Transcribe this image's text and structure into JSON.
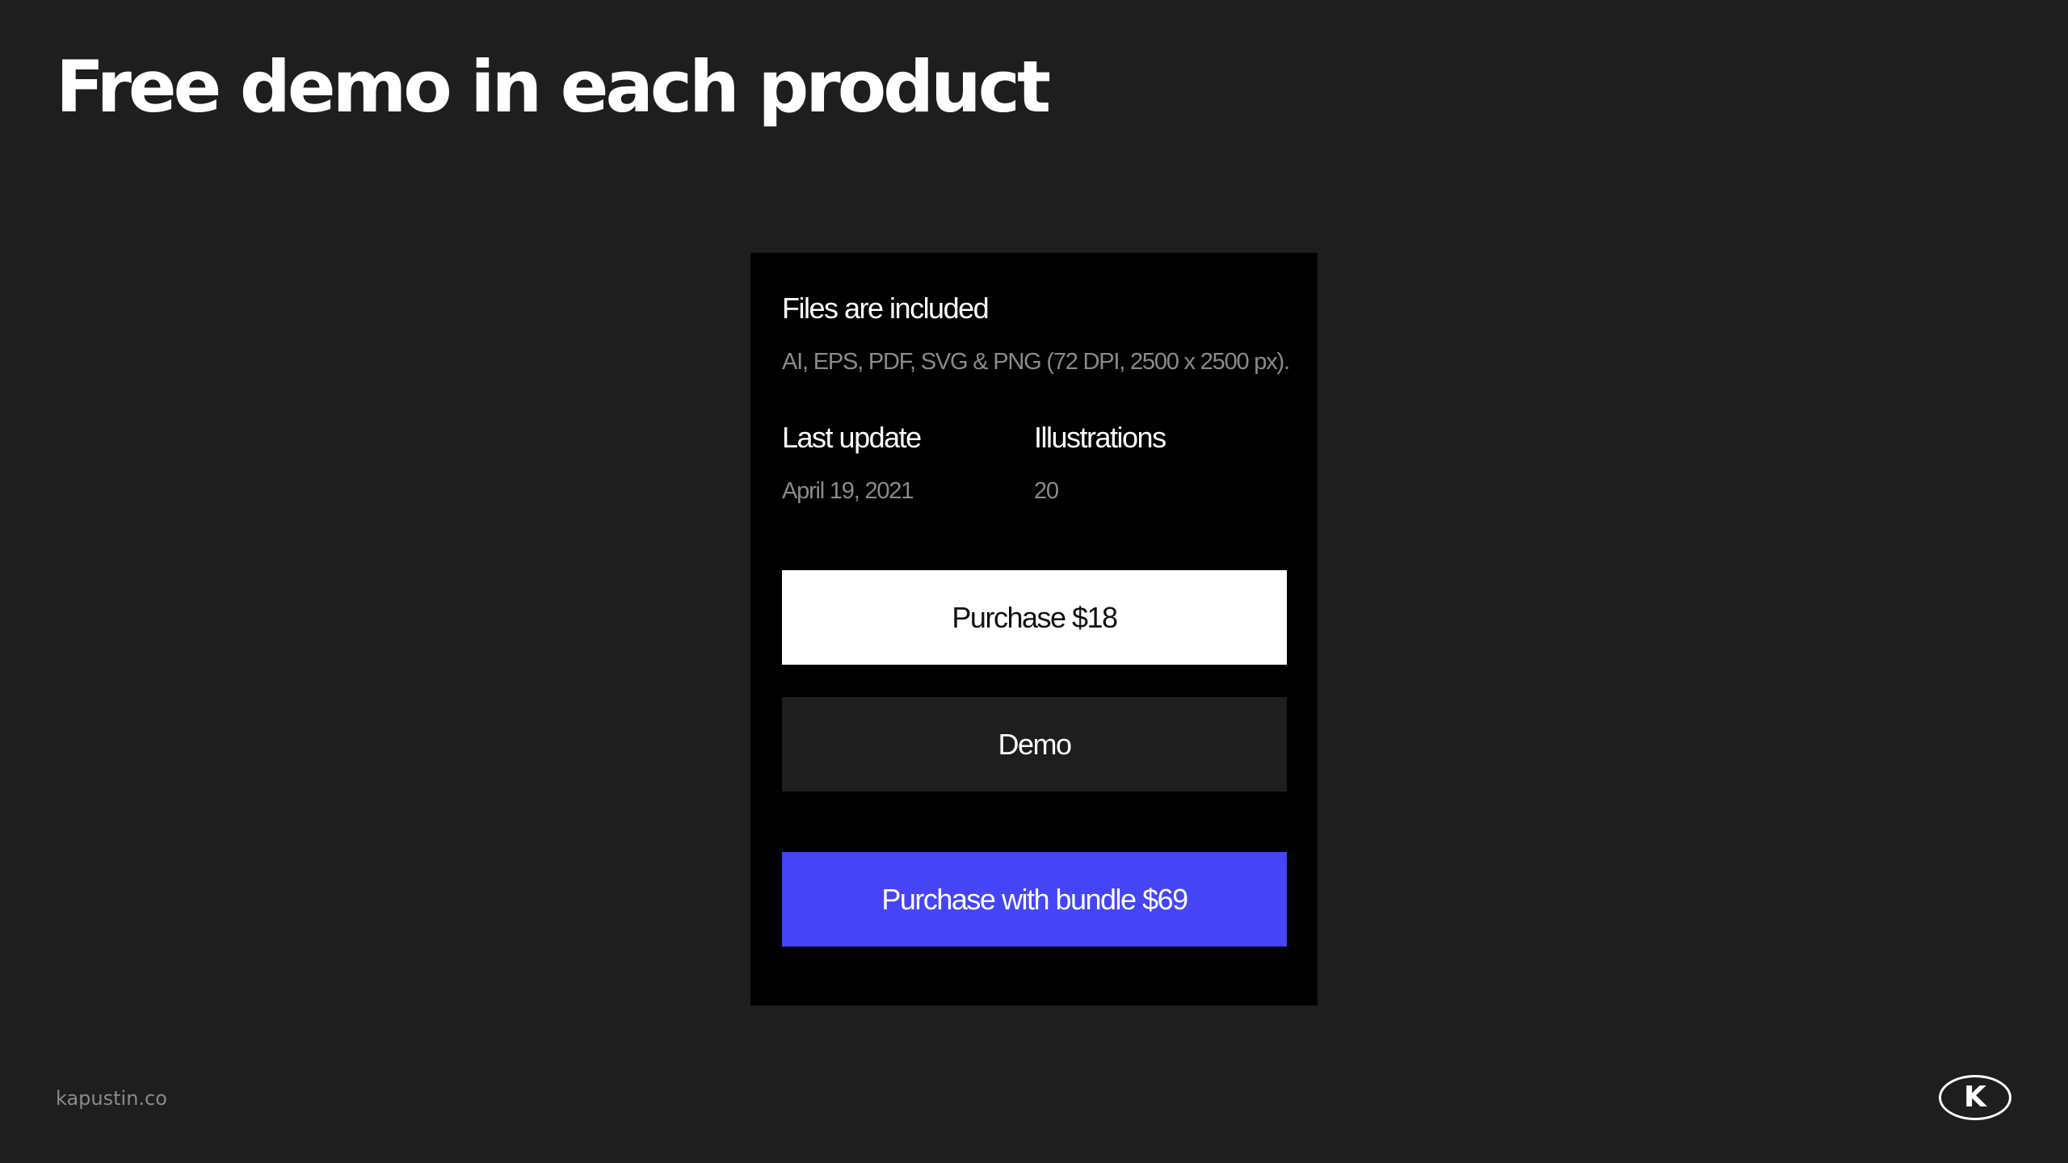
{
  "slide": {
    "title": "Free demo in each product"
  },
  "card": {
    "files_heading": "Files are included",
    "files_description": "AI, EPS, PDF, SVG & PNG (72 DPI, 2500 x 2500 px).",
    "last_update_label": "Last update",
    "last_update_value": "April 19, 2021",
    "illustrations_label": "Illustrations",
    "illustrations_value": "20",
    "purchase_button_label": "Purchase $18",
    "demo_button_label": "Demo",
    "bundle_button_label": "Purchase with bundle $69"
  },
  "footer": {
    "site": "kapustin.co",
    "logo_letter": "K"
  },
  "colors": {
    "background": "#1e1e1e",
    "card": "#000000",
    "bundle_accent": "#4545f7",
    "muted_text": "#8a8a8a"
  },
  "icons": {
    "logo": "k-logo-icon"
  }
}
